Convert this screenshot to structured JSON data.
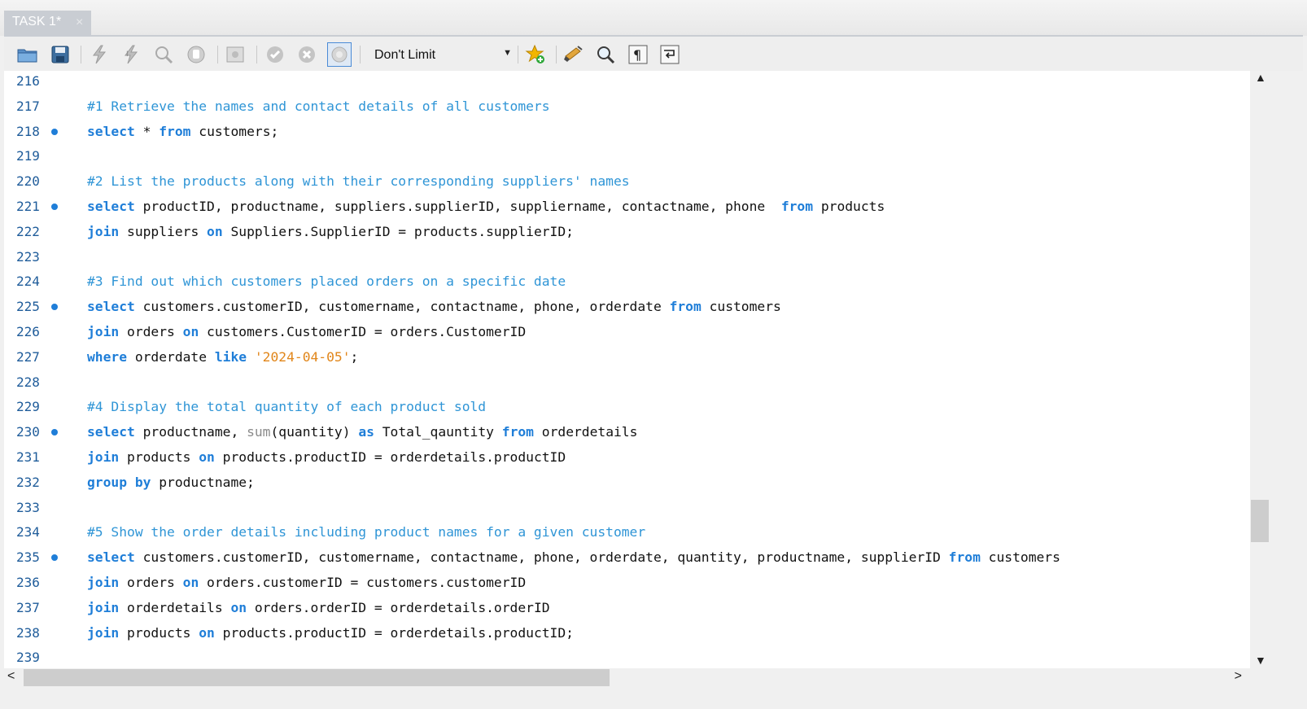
{
  "tab": {
    "title": "TASK 1*",
    "close": "×"
  },
  "toolbar": {
    "limit_value": "Don't Limit",
    "icons": [
      "open-folder-icon",
      "save-icon",
      "execute-icon",
      "execute-current-icon",
      "explain-icon",
      "stop-icon",
      "toggle-output-icon",
      "commit-icon",
      "rollback-icon",
      "autocommit-icon",
      "favorite-add-icon",
      "beautify-icon",
      "find-icon",
      "invisible-chars-icon",
      "wrap-icon"
    ]
  },
  "colors": {
    "keyword": "#1f7ed8",
    "comment": "#2f95d6",
    "string": "#e1861a",
    "line_number": "#1f5c9a",
    "marker": "#1f7ed8"
  },
  "editor": {
    "lines": [
      {
        "num": "216",
        "segments": []
      },
      {
        "num": "217",
        "segments": [
          {
            "t": "#1 Retrieve the names and contact details of all customers",
            "c": "cm"
          }
        ]
      },
      {
        "num": "218",
        "marker": true,
        "segments": [
          {
            "t": "select",
            "c": "kw"
          },
          {
            "t": " * "
          },
          {
            "t": "from",
            "c": "kw"
          },
          {
            "t": " customers;"
          }
        ]
      },
      {
        "num": "219",
        "segments": []
      },
      {
        "num": "220",
        "segments": [
          {
            "t": "#2 List the products along with their corresponding suppliers' names",
            "c": "cm"
          }
        ]
      },
      {
        "num": "221",
        "marker": true,
        "segments": [
          {
            "t": "select",
            "c": "kw"
          },
          {
            "t": " productID, productname, suppliers.supplierID, suppliername, contactname, phone  "
          },
          {
            "t": "from",
            "c": "kw"
          },
          {
            "t": " products"
          }
        ]
      },
      {
        "num": "222",
        "segments": [
          {
            "t": "join",
            "c": "kw"
          },
          {
            "t": " suppliers "
          },
          {
            "t": "on",
            "c": "kw"
          },
          {
            "t": " Suppliers.SupplierID = products.supplierID;"
          }
        ]
      },
      {
        "num": "223",
        "segments": []
      },
      {
        "num": "224",
        "segments": [
          {
            "t": "#3 Find out which customers placed orders on a specific date",
            "c": "cm"
          }
        ]
      },
      {
        "num": "225",
        "marker": true,
        "segments": [
          {
            "t": "select",
            "c": "kw"
          },
          {
            "t": " customers.customerID, customername, contactname, phone, orderdate "
          },
          {
            "t": "from",
            "c": "kw"
          },
          {
            "t": " customers"
          }
        ]
      },
      {
        "num": "226",
        "segments": [
          {
            "t": "join",
            "c": "kw"
          },
          {
            "t": " orders "
          },
          {
            "t": "on",
            "c": "kw"
          },
          {
            "t": " customers.CustomerID = orders.CustomerID"
          }
        ]
      },
      {
        "num": "227",
        "segments": [
          {
            "t": "where",
            "c": "kw"
          },
          {
            "t": " orderdate "
          },
          {
            "t": "like",
            "c": "kw"
          },
          {
            "t": " "
          },
          {
            "t": "'2024-04-05'",
            "c": "st"
          },
          {
            "t": ";"
          }
        ]
      },
      {
        "num": "228",
        "segments": []
      },
      {
        "num": "229",
        "segments": [
          {
            "t": "#4 Display the total quantity of each product sold",
            "c": "cm"
          }
        ]
      },
      {
        "num": "230",
        "marker": true,
        "segments": [
          {
            "t": "select",
            "c": "kw"
          },
          {
            "t": " productname, "
          },
          {
            "t": "sum",
            "c": "fn"
          },
          {
            "t": "(quantity) "
          },
          {
            "t": "as",
            "c": "kw"
          },
          {
            "t": " Total_qauntity "
          },
          {
            "t": "from",
            "c": "kw"
          },
          {
            "t": " orderdetails"
          }
        ]
      },
      {
        "num": "231",
        "segments": [
          {
            "t": "join",
            "c": "kw"
          },
          {
            "t": " products "
          },
          {
            "t": "on",
            "c": "kw"
          },
          {
            "t": " products.productID = orderdetails.productID"
          }
        ]
      },
      {
        "num": "232",
        "segments": [
          {
            "t": "group by",
            "c": "kw"
          },
          {
            "t": " productname;"
          }
        ]
      },
      {
        "num": "233",
        "segments": []
      },
      {
        "num": "234",
        "segments": [
          {
            "t": "#5 Show the order details including product names for a given customer",
            "c": "cm"
          }
        ]
      },
      {
        "num": "235",
        "marker": true,
        "segments": [
          {
            "t": "select",
            "c": "kw"
          },
          {
            "t": " customers.customerID, customername, contactname, phone, orderdate, quantity, productname, supplierID "
          },
          {
            "t": "from",
            "c": "kw"
          },
          {
            "t": " customers"
          }
        ]
      },
      {
        "num": "236",
        "segments": [
          {
            "t": "join",
            "c": "kw"
          },
          {
            "t": " orders "
          },
          {
            "t": "on",
            "c": "kw"
          },
          {
            "t": " orders.customerID = customers.customerID"
          }
        ]
      },
      {
        "num": "237",
        "segments": [
          {
            "t": "join",
            "c": "kw"
          },
          {
            "t": " orderdetails "
          },
          {
            "t": "on",
            "c": "kw"
          },
          {
            "t": " orders.orderID = orderdetails.orderID"
          }
        ]
      },
      {
        "num": "238",
        "segments": [
          {
            "t": "join",
            "c": "kw"
          },
          {
            "t": " products "
          },
          {
            "t": "on",
            "c": "kw"
          },
          {
            "t": " products.productID = orderdetails.productID;"
          }
        ]
      },
      {
        "num": "239",
        "segments": []
      }
    ]
  },
  "scrollbars": {
    "up": "▲",
    "down": "▼",
    "left": "<",
    "right": ">"
  }
}
